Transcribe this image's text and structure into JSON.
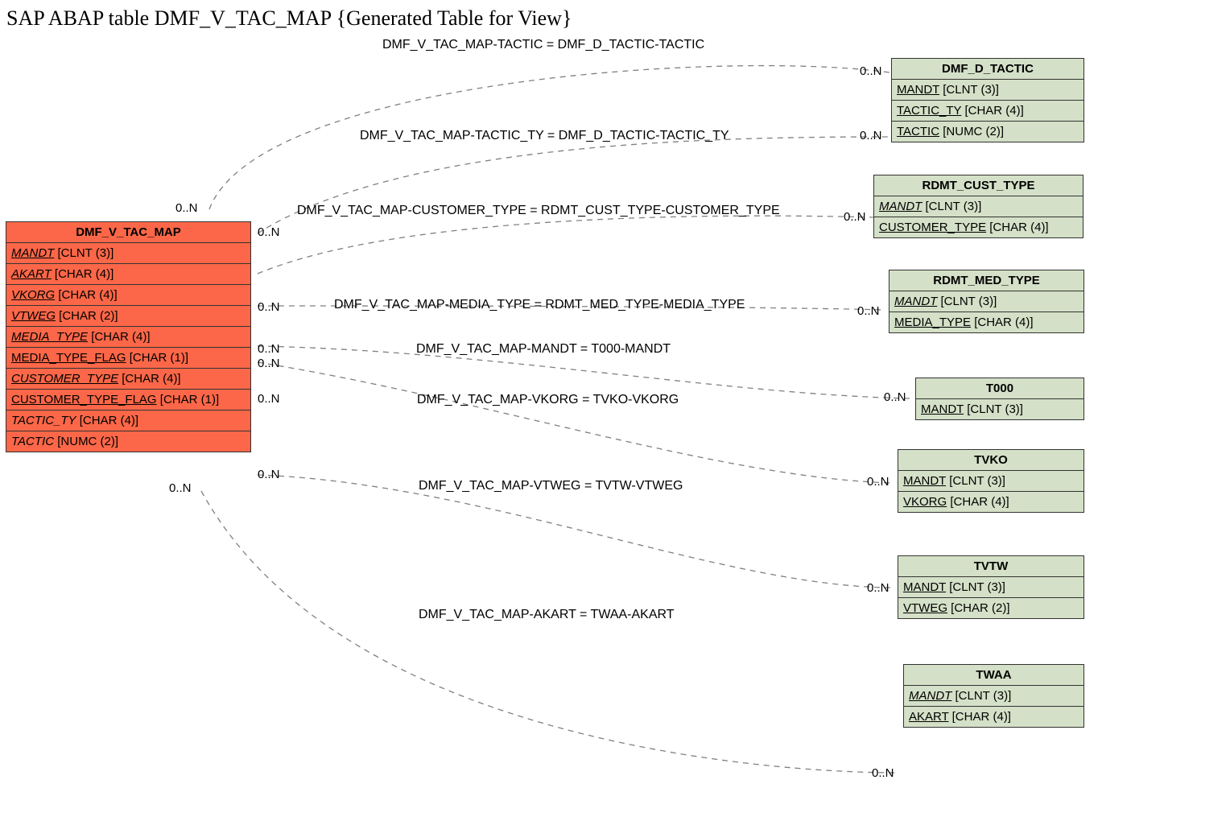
{
  "title": "SAP ABAP table DMF_V_TAC_MAP {Generated Table for View}",
  "main": {
    "name": "DMF_V_TAC_MAP",
    "rows": [
      {
        "field": "MANDT",
        "type": "[CLNT (3)]",
        "u": true,
        "i": true
      },
      {
        "field": "AKART",
        "type": "[CHAR (4)]",
        "u": true,
        "i": true
      },
      {
        "field": "VKORG",
        "type": "[CHAR (4)]",
        "u": true,
        "i": true
      },
      {
        "field": "VTWEG",
        "type": "[CHAR (2)]",
        "u": true,
        "i": true
      },
      {
        "field": "MEDIA_TYPE",
        "type": "[CHAR (4)]",
        "u": true,
        "i": true
      },
      {
        "field": "MEDIA_TYPE_FLAG",
        "type": "[CHAR (1)]",
        "u": true,
        "i": false
      },
      {
        "field": "CUSTOMER_TYPE",
        "type": "[CHAR (4)]",
        "u": true,
        "i": true
      },
      {
        "field": "CUSTOMER_TYPE_FLAG",
        "type": "[CHAR (1)]",
        "u": true,
        "i": false
      },
      {
        "field": "TACTIC_TY",
        "type": "[CHAR (4)]",
        "u": false,
        "i": true
      },
      {
        "field": "TACTIC",
        "type": "[NUMC (2)]",
        "u": false,
        "i": true
      }
    ]
  },
  "refs": [
    {
      "id": "dmf_d_tactic",
      "name": "DMF_D_TACTIC",
      "rows": [
        {
          "field": "MANDT",
          "type": "[CLNT (3)]",
          "u": true,
          "i": false
        },
        {
          "field": "TACTIC_TY",
          "type": "[CHAR (4)]",
          "u": true,
          "i": false
        },
        {
          "field": "TACTIC",
          "type": "[NUMC (2)]",
          "u": true,
          "i": false
        }
      ]
    },
    {
      "id": "rdmt_cust_type",
      "name": "RDMT_CUST_TYPE",
      "rows": [
        {
          "field": "MANDT",
          "type": "[CLNT (3)]",
          "u": true,
          "i": true
        },
        {
          "field": "CUSTOMER_TYPE",
          "type": "[CHAR (4)]",
          "u": true,
          "i": false
        }
      ]
    },
    {
      "id": "rdmt_med_type",
      "name": "RDMT_MED_TYPE",
      "rows": [
        {
          "field": "MANDT",
          "type": "[CLNT (3)]",
          "u": true,
          "i": true
        },
        {
          "field": "MEDIA_TYPE",
          "type": "[CHAR (4)]",
          "u": true,
          "i": false
        }
      ]
    },
    {
      "id": "t000",
      "name": "T000",
      "rows": [
        {
          "field": "MANDT",
          "type": "[CLNT (3)]",
          "u": true,
          "i": false
        }
      ]
    },
    {
      "id": "tvko",
      "name": "TVKO",
      "rows": [
        {
          "field": "MANDT",
          "type": "[CLNT (3)]",
          "u": true,
          "i": false
        },
        {
          "field": "VKORG",
          "type": "[CHAR (4)]",
          "u": true,
          "i": false
        }
      ]
    },
    {
      "id": "tvtw",
      "name": "TVTW",
      "rows": [
        {
          "field": "MANDT",
          "type": "[CLNT (3)]",
          "u": true,
          "i": false
        },
        {
          "field": "VTWEG",
          "type": "[CHAR (2)]",
          "u": true,
          "i": false
        }
      ]
    },
    {
      "id": "twaa",
      "name": "TWAA",
      "rows": [
        {
          "field": "MANDT",
          "type": "[CLNT (3)]",
          "u": true,
          "i": true
        },
        {
          "field": "AKART",
          "type": "[CHAR (4)]",
          "u": true,
          "i": false
        }
      ]
    }
  ],
  "rels": [
    {
      "label": "DMF_V_TAC_MAP-TACTIC = DMF_D_TACTIC-TACTIC"
    },
    {
      "label": "DMF_V_TAC_MAP-TACTIC_TY = DMF_D_TACTIC-TACTIC_TY"
    },
    {
      "label": "DMF_V_TAC_MAP-CUSTOMER_TYPE = RDMT_CUST_TYPE-CUSTOMER_TYPE"
    },
    {
      "label": "DMF_V_TAC_MAP-MEDIA_TYPE = RDMT_MED_TYPE-MEDIA_TYPE"
    },
    {
      "label": "DMF_V_TAC_MAP-MANDT = T000-MANDT"
    },
    {
      "label": "DMF_V_TAC_MAP-VKORG = TVKO-VKORG"
    },
    {
      "label": "DMF_V_TAC_MAP-VTWEG = TVTW-VTWEG"
    },
    {
      "label": "DMF_V_TAC_MAP-AKART = TWAA-AKART"
    }
  ],
  "card": "0..N"
}
